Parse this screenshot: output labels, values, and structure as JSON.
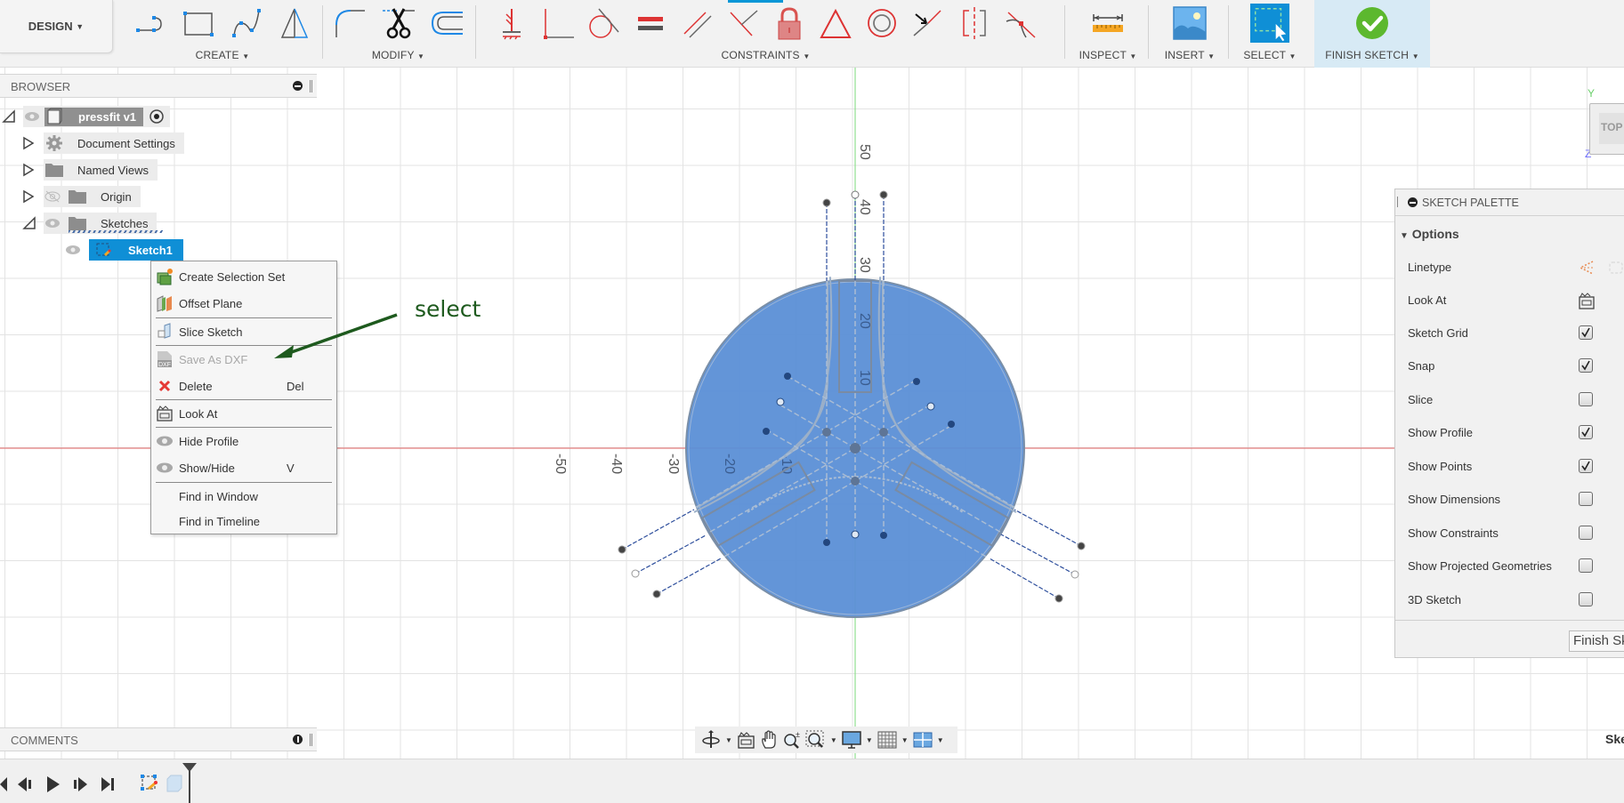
{
  "workspace": {
    "label": "DESIGN"
  },
  "toolbar": {
    "groups": [
      {
        "id": "create",
        "label": "CREATE",
        "icons": [
          "arc-slot-icon",
          "rectangle-icon",
          "spline-icon",
          "mirror-icon"
        ]
      },
      {
        "id": "modify",
        "label": "MODIFY",
        "icons": [
          "fillet-icon",
          "trim-icon",
          "offset-icon"
        ]
      },
      {
        "id": "constraints",
        "label": "CONSTRAINTS",
        "icons": [
          "fix-icon",
          "perpendicular-icon",
          "tangent-icon",
          "equal-icon",
          "parallel-icon",
          "coincident-icon",
          "lock-icon",
          "triangle-icon",
          "concentric-icon",
          "midpoint-icon",
          "symmetric-icon",
          "curvature-icon"
        ]
      },
      {
        "id": "inspect",
        "label": "INSPECT",
        "icons": [
          "measure-icon"
        ]
      },
      {
        "id": "insert",
        "label": "INSERT",
        "icons": [
          "insert-image-icon"
        ]
      },
      {
        "id": "select",
        "label": "SELECT",
        "icons": [
          "window-select-icon"
        ]
      },
      {
        "id": "finish",
        "label": "FINISH SKETCH",
        "icons": [
          "finish-checkmark-icon"
        ]
      }
    ]
  },
  "browser": {
    "title": "BROWSER",
    "root": {
      "label": "pressfit v1"
    },
    "items": [
      {
        "label": "Document Settings",
        "icon": "gear-icon",
        "expanded": false
      },
      {
        "label": "Named Views",
        "icon": "folder-icon",
        "expanded": false
      },
      {
        "label": "Origin",
        "icon": "folder-icon",
        "expanded": false,
        "visible": false
      },
      {
        "label": "Sketches",
        "icon": "folder-icon",
        "expanded": true
      }
    ],
    "selected": {
      "label": "Sketch1"
    }
  },
  "context_menu": {
    "items": [
      {
        "label": "Create Selection Set",
        "icon": "selection-set-icon",
        "shortcut": ""
      },
      {
        "label": "Offset Plane",
        "icon": "offset-plane-icon",
        "shortcut": ""
      },
      {
        "label": "Slice Sketch",
        "icon": "slice-icon",
        "shortcut": ""
      },
      {
        "label": "Save As DXF",
        "icon": "dxf-icon",
        "shortcut": "",
        "highlighted": true
      },
      {
        "label": "Delete",
        "icon": "delete-x-icon",
        "shortcut": "Del"
      },
      {
        "label": "Look At",
        "icon": "look-at-icon",
        "shortcut": ""
      },
      {
        "label": "Hide Profile",
        "icon": "eye-icon",
        "shortcut": ""
      },
      {
        "label": "Show/Hide",
        "icon": "eye-icon",
        "shortcut": "V"
      },
      {
        "label": "Find in Window",
        "icon": "",
        "shortcut": ""
      },
      {
        "label": "Find in Timeline",
        "icon": "",
        "shortcut": ""
      }
    ]
  },
  "annotation": {
    "text": "select",
    "color": "#1e5a1e"
  },
  "canvas": {
    "axis_labels_x": [
      "-50",
      "-40",
      "-30",
      "-20",
      "-10"
    ],
    "axis_labels_y": [
      "50",
      "40",
      "30",
      "20",
      "10"
    ],
    "profile_color": "#5b8fd6"
  },
  "sketch_palette": {
    "title": "SKETCH PALETTE",
    "section": "Options",
    "rows": [
      {
        "label": "Linetype",
        "type": "icons"
      },
      {
        "label": "Look At",
        "type": "button"
      },
      {
        "label": "Sketch Grid",
        "type": "checkbox",
        "checked": true
      },
      {
        "label": "Snap",
        "type": "checkbox",
        "checked": true
      },
      {
        "label": "Slice",
        "type": "checkbox",
        "checked": false
      },
      {
        "label": "Show Profile",
        "type": "checkbox",
        "checked": true
      },
      {
        "label": "Show Points",
        "type": "checkbox",
        "checked": true
      },
      {
        "label": "Show Dimensions",
        "type": "checkbox",
        "checked": false
      },
      {
        "label": "Show Constraints",
        "type": "checkbox",
        "checked": false
      },
      {
        "label": "Show Projected Geometries",
        "type": "checkbox",
        "checked": false
      },
      {
        "label": "3D Sketch",
        "type": "checkbox",
        "checked": false
      }
    ],
    "finish_button": "Finish Sketch"
  },
  "viewcube": {
    "face": "TOP",
    "axis_y": "Y",
    "axis_z": "Z"
  },
  "comments": {
    "title": "COMMENTS"
  },
  "status": {
    "right_text": "Sketch"
  },
  "navbar": {
    "icons": [
      "orbit-icon",
      "look-at-icon",
      "pan-icon",
      "zoom-icon",
      "zoom-window-icon",
      "display-settings-icon",
      "grid-settings-icon",
      "viewports-icon"
    ]
  }
}
